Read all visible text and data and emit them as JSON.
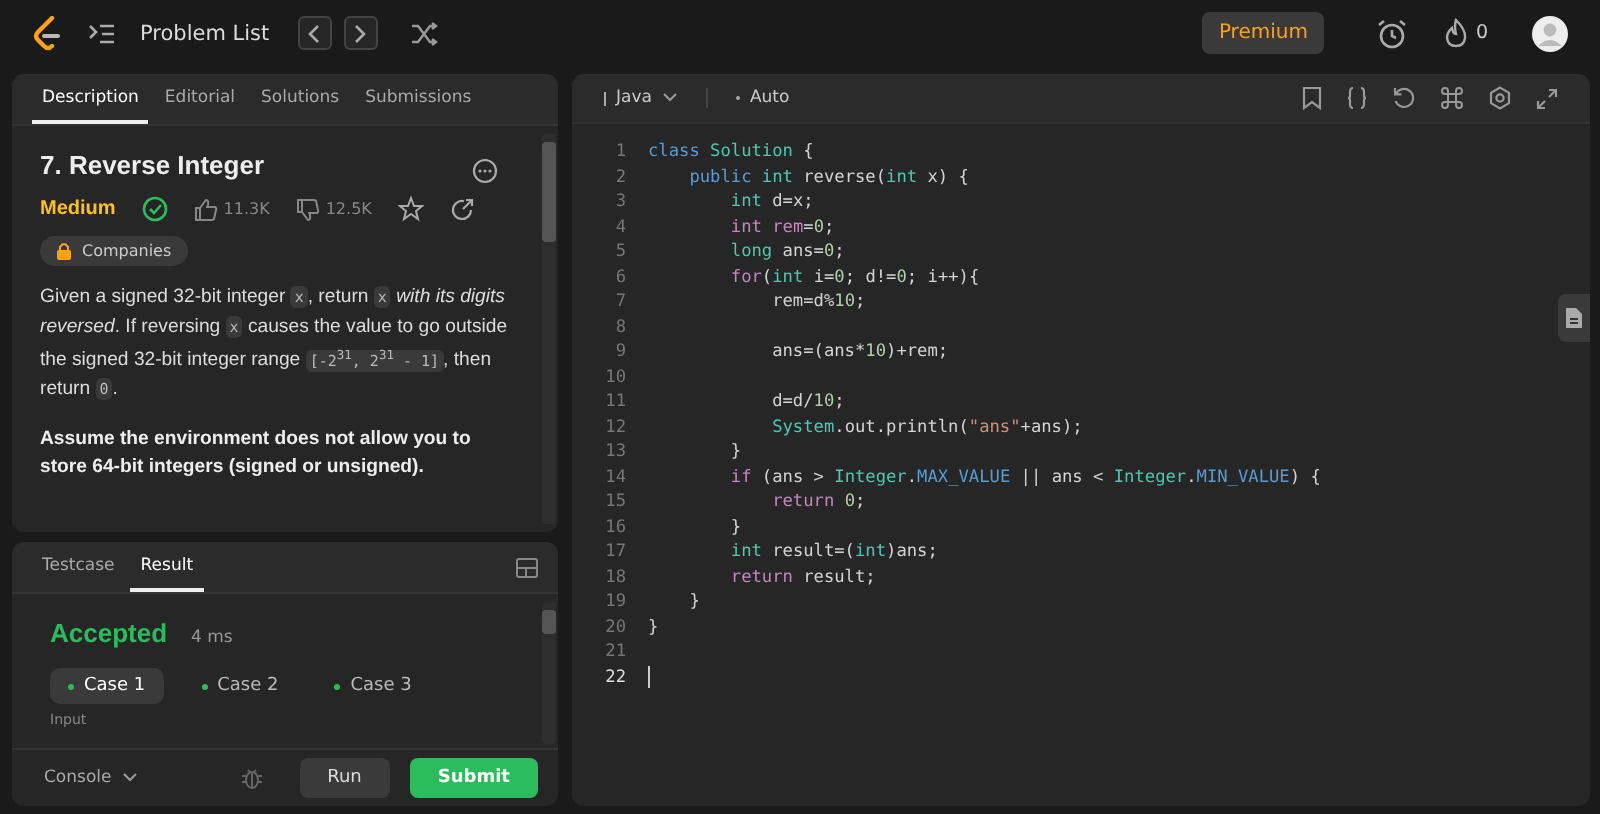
{
  "top_bar": {
    "title": "Problem List",
    "premium": "Premium",
    "streak": "0"
  },
  "description": {
    "tabs": [
      {
        "label": "Description",
        "selected": true
      },
      {
        "label": "Editorial",
        "selected": false
      },
      {
        "label": "Solutions",
        "selected": false
      },
      {
        "label": "Submissions",
        "selected": false
      }
    ],
    "title": "7. Reverse Integer",
    "difficulty": "Medium",
    "likes": "11.3K",
    "dislikes": "12.5K",
    "companies": "Companies",
    "paragraph": [
      {
        "kind": "text",
        "text": "Given a signed 32-bit integer "
      },
      {
        "kind": "code",
        "text": "x"
      },
      {
        "kind": "text",
        "text": ", return "
      },
      {
        "kind": "code",
        "text": "x"
      },
      {
        "kind": "italic",
        "text": " with its digits reversed"
      },
      {
        "kind": "text",
        "text": ". If reversing "
      },
      {
        "kind": "code",
        "text": "x"
      },
      {
        "kind": "text",
        "text": " causes the value to go outside the signed 32-bit integer range "
      },
      {
        "kind": "code",
        "text": "[-2$^{31}$, 2$^{31}$ - 1]"
      },
      {
        "kind": "text",
        "text": ", then return "
      },
      {
        "kind": "code",
        "text": "0"
      },
      {
        "kind": "text",
        "text": "."
      }
    ],
    "note": "Assume the environment does not allow you to store 64-bit integers (signed or unsigned)."
  },
  "result": {
    "tabs": [
      {
        "label": "Testcase",
        "selected": false
      },
      {
        "label": "Result",
        "selected": true
      }
    ],
    "status": "Accepted",
    "runtime": "4 ms",
    "cases": [
      {
        "label": "Case 1",
        "selected": true
      },
      {
        "label": "Case 2",
        "selected": false
      },
      {
        "label": "Case 3",
        "selected": false
      }
    ],
    "input_label": "Input"
  },
  "console": {
    "label": "Console",
    "run": "Run",
    "submit": "Submit"
  },
  "editor": {
    "language": "Java",
    "mode": "Auto",
    "lines": [
      {
        "number": "1",
        "active": false,
        "tokens": [
          {
            "kind": "keyword",
            "text": "class "
          },
          {
            "kind": "type",
            "text": "Solution"
          },
          {
            "kind": "plain",
            "text": " {"
          }
        ]
      },
      {
        "number": "2",
        "active": false,
        "tokens": [
          {
            "kind": "keyword",
            "text": "    public "
          },
          {
            "kind": "type",
            "text": "int "
          },
          {
            "kind": "plain",
            "text": "reverse("
          },
          {
            "kind": "type",
            "text": "int "
          },
          {
            "kind": "plain",
            "text": "x) {"
          }
        ]
      },
      {
        "number": "3",
        "active": false,
        "tokens": [
          {
            "kind": "type",
            "text": "        int "
          },
          {
            "kind": "plain",
            "text": "d=x;"
          }
        ]
      },
      {
        "number": "4",
        "active": false,
        "tokens": [
          {
            "kind": "control",
            "text": "        int "
          },
          {
            "kind": "control",
            "text": "rem"
          },
          {
            "kind": "plain",
            "text": "="
          },
          {
            "kind": "number",
            "text": "0"
          },
          {
            "kind": "plain",
            "text": ";"
          }
        ]
      },
      {
        "number": "5",
        "active": false,
        "tokens": [
          {
            "kind": "type",
            "text": "        long "
          },
          {
            "kind": "plain",
            "text": "ans="
          },
          {
            "kind": "number",
            "text": "0"
          },
          {
            "kind": "plain",
            "text": ";"
          }
        ]
      },
      {
        "number": "6",
        "active": false,
        "tokens": [
          {
            "kind": "control",
            "text": "        for"
          },
          {
            "kind": "plain",
            "text": "("
          },
          {
            "kind": "type",
            "text": "int "
          },
          {
            "kind": "plain",
            "text": "i="
          },
          {
            "kind": "number",
            "text": "0"
          },
          {
            "kind": "plain",
            "text": "; d!="
          },
          {
            "kind": "number",
            "text": "0"
          },
          {
            "kind": "plain",
            "text": "; i++){"
          }
        ]
      },
      {
        "number": "7",
        "active": false,
        "tokens": [
          {
            "kind": "plain",
            "text": "            rem=d%"
          },
          {
            "kind": "number",
            "text": "10"
          },
          {
            "kind": "plain",
            "text": ";"
          }
        ]
      },
      {
        "number": "8",
        "active": false
      },
      {
        "number": "9",
        "active": false,
        "tokens": [
          {
            "kind": "plain",
            "text": "            ans=(ans*"
          },
          {
            "kind": "number",
            "text": "10"
          },
          {
            "kind": "plain",
            "text": ")+rem;"
          }
        ]
      },
      {
        "number": "10",
        "active": false
      },
      {
        "number": "11",
        "active": false,
        "tokens": [
          {
            "kind": "plain",
            "text": "            d=d/"
          },
          {
            "kind": "number",
            "text": "10"
          },
          {
            "kind": "plain",
            "text": ";"
          }
        ]
      },
      {
        "number": "12",
        "active": false,
        "tokens": [
          {
            "kind": "type",
            "text": "            System"
          },
          {
            "kind": "plain",
            "text": ".out.println("
          },
          {
            "kind": "string",
            "text": "\"ans\""
          },
          {
            "kind": "plain",
            "text": "+ans);"
          }
        ]
      },
      {
        "number": "13",
        "active": false,
        "tokens": [
          {
            "kind": "plain",
            "text": "        }"
          }
        ]
      },
      {
        "number": "14",
        "active": false,
        "tokens": [
          {
            "kind": "control",
            "text": "        if "
          },
          {
            "kind": "plain",
            "text": "(ans > "
          },
          {
            "kind": "type",
            "text": "Integer"
          },
          {
            "kind": "plain",
            "text": "."
          },
          {
            "kind": "keyword",
            "text": "MAX_VALUE"
          },
          {
            "kind": "plain",
            "text": " || ans < "
          },
          {
            "kind": "type",
            "text": "Integer"
          },
          {
            "kind": "plain",
            "text": "."
          },
          {
            "kind": "keyword",
            "text": "MIN_VALUE"
          },
          {
            "kind": "plain",
            "text": ") {"
          }
        ]
      },
      {
        "number": "15",
        "active": false,
        "tokens": [
          {
            "kind": "control",
            "text": "            return "
          },
          {
            "kind": "number",
            "text": "0"
          },
          {
            "kind": "plain",
            "text": ";"
          }
        ]
      },
      {
        "number": "16",
        "active": false,
        "tokens": [
          {
            "kind": "plain",
            "text": "        }"
          }
        ]
      },
      {
        "number": "17",
        "active": false,
        "tokens": [
          {
            "kind": "type",
            "text": "        int "
          },
          {
            "kind": "plain",
            "text": "result=("
          },
          {
            "kind": "type",
            "text": "int"
          },
          {
            "kind": "plain",
            "text": ")ans;"
          }
        ]
      },
      {
        "number": "18",
        "active": false,
        "tokens": [
          {
            "kind": "control",
            "text": "        return "
          },
          {
            "kind": "plain",
            "text": "result;"
          }
        ]
      },
      {
        "number": "19",
        "active": false,
        "tokens": [
          {
            "kind": "plain",
            "text": "    }"
          }
        ]
      },
      {
        "number": "20",
        "active": false,
        "tokens": [
          {
            "kind": "plain",
            "text": "}"
          }
        ]
      },
      {
        "number": "21",
        "active": false
      },
      {
        "number": "22",
        "active": true
      }
    ]
  }
}
